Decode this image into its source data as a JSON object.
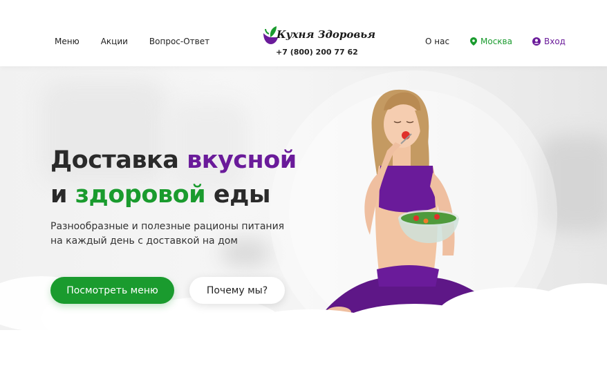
{
  "header": {
    "nav_left": [
      "Меню",
      "Акции",
      "Вопрос-Ответ"
    ],
    "logo_text": "Кухня Здоровья",
    "phone": "+7 (800) 200 77 62",
    "about": "О нас",
    "city": "Москва",
    "login": "Вход"
  },
  "hero": {
    "title_line1_a": "Доставка ",
    "title_line1_b": "вкусной",
    "title_line2_a": "и ",
    "title_line2_b": "здоровой",
    "title_line2_c": " еды",
    "subtitle_line1": "Разнообразные и полезные рационы питания",
    "subtitle_line2": "на каждый день с доставкой на дом",
    "primary_button": "Посмотреть меню",
    "secondary_button": "Почему мы?"
  },
  "colors": {
    "brand_green": "#1a9b2e",
    "brand_purple": "#6a1b9a"
  },
  "icons": {
    "city": "map-pin-icon",
    "login": "user-circle-icon",
    "logo": "leaf-bowl-icon"
  }
}
